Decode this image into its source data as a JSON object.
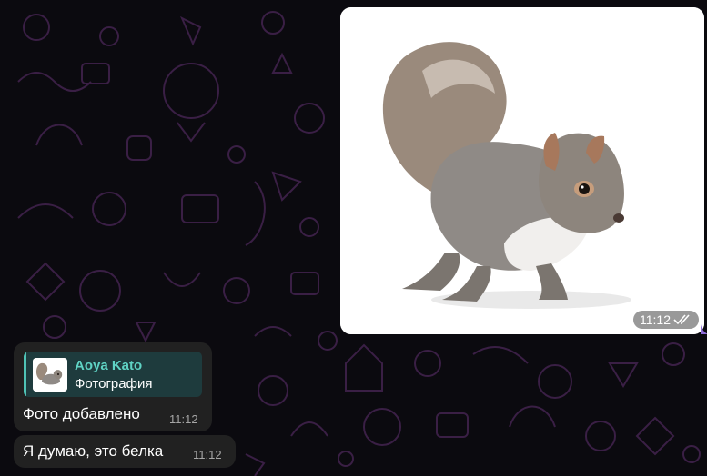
{
  "chat": {
    "outgoing_photo": {
      "time": "11:12",
      "status_icon": "double-check-icon",
      "image_subject": "squirrel"
    },
    "incoming": [
      {
        "reply": {
          "author": "Aoya Kato",
          "type_label": "Фотография",
          "author_color": "#5fd3c4"
        },
        "text": "Фото добавлено",
        "time": "11:12"
      },
      {
        "text": "Я думаю, это белка",
        "time": "11:12"
      }
    ]
  },
  "colors": {
    "background": "#0b0a0f",
    "wallpaper_doodle": "#3a1f45",
    "bubble_incoming": "#212121",
    "reply_bg": "#1e3b3d",
    "accent": "#4fc3b6"
  }
}
